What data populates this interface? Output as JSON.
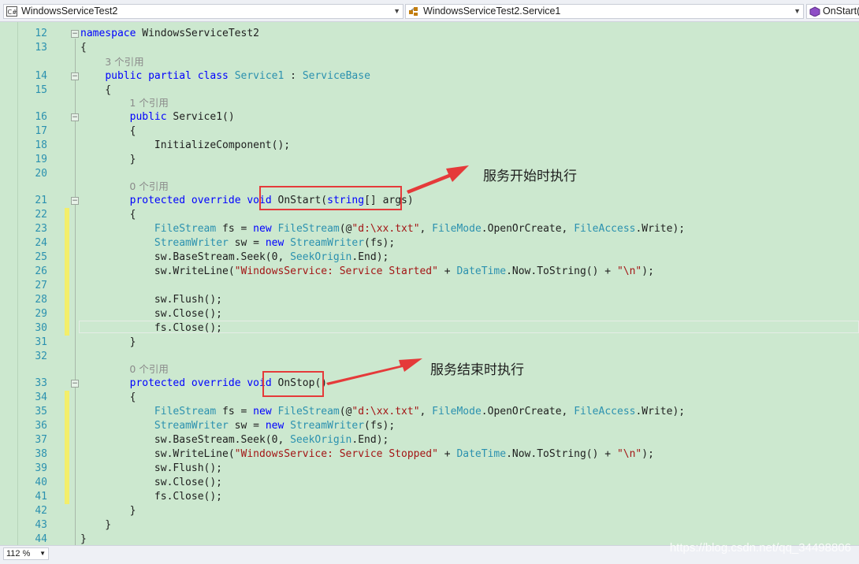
{
  "navbar": {
    "project_combo": "WindowsServiceTest2",
    "class_combo": "WindowsServiceTest2.Service1",
    "member_combo": "OnStart(s"
  },
  "editor": {
    "ref_counts": {
      "l14": "3 个引用",
      "l16": "1 个引用",
      "l21": "0 个引用",
      "l33": "0 个引用"
    },
    "line_numbers": [
      "12",
      "13",
      "14",
      "15",
      "16",
      "17",
      "18",
      "19",
      "20",
      "21",
      "22",
      "23",
      "24",
      "25",
      "26",
      "27",
      "28",
      "29",
      "30",
      "31",
      "32",
      "33",
      "34",
      "35",
      "36",
      "37",
      "38",
      "39",
      "40",
      "41",
      "42",
      "43",
      "44"
    ],
    "code": {
      "l12": [
        {
          "t": "namespace",
          "c": "kw"
        },
        {
          "t": " WindowsServiceTest2"
        }
      ],
      "l13": [
        {
          "t": "{"
        }
      ],
      "l14": [
        {
          "t": "    "
        },
        {
          "t": "public",
          "c": "kw"
        },
        {
          "t": " "
        },
        {
          "t": "partial",
          "c": "kw"
        },
        {
          "t": " "
        },
        {
          "t": "class",
          "c": "kw"
        },
        {
          "t": " "
        },
        {
          "t": "Service1",
          "c": "ty"
        },
        {
          "t": " : "
        },
        {
          "t": "ServiceBase",
          "c": "ty"
        }
      ],
      "l15": [
        {
          "t": "    {"
        }
      ],
      "l16": [
        {
          "t": "        "
        },
        {
          "t": "public",
          "c": "kw"
        },
        {
          "t": " Service1()"
        }
      ],
      "l17": [
        {
          "t": "        {"
        }
      ],
      "l18": [
        {
          "t": "            InitializeComponent();"
        }
      ],
      "l19": [
        {
          "t": "        }"
        }
      ],
      "l20": [
        {
          "t": ""
        }
      ],
      "l21": [
        {
          "t": "        "
        },
        {
          "t": "protected",
          "c": "kw"
        },
        {
          "t": " "
        },
        {
          "t": "override",
          "c": "kw"
        },
        {
          "t": " "
        },
        {
          "t": "void",
          "c": "kw"
        },
        {
          "t": " OnStart("
        },
        {
          "t": "string",
          "c": "kw"
        },
        {
          "t": "[] args)"
        }
      ],
      "l22": [
        {
          "t": "        {"
        }
      ],
      "l23": [
        {
          "t": "            "
        },
        {
          "t": "FileStream",
          "c": "ty"
        },
        {
          "t": " fs = "
        },
        {
          "t": "new",
          "c": "kw"
        },
        {
          "t": " "
        },
        {
          "t": "FileStream",
          "c": "ty"
        },
        {
          "t": "(@"
        },
        {
          "t": "\"d:\\xx.txt\"",
          "c": "st"
        },
        {
          "t": ", "
        },
        {
          "t": "FileMode",
          "c": "ty"
        },
        {
          "t": ".OpenOrCreate, "
        },
        {
          "t": "FileAccess",
          "c": "ty"
        },
        {
          "t": ".Write);"
        }
      ],
      "l24": [
        {
          "t": "            "
        },
        {
          "t": "StreamWriter",
          "c": "ty"
        },
        {
          "t": " sw = "
        },
        {
          "t": "new",
          "c": "kw"
        },
        {
          "t": " "
        },
        {
          "t": "StreamWriter",
          "c": "ty"
        },
        {
          "t": "(fs);"
        }
      ],
      "l25": [
        {
          "t": "            sw.BaseStream.Seek(0, "
        },
        {
          "t": "SeekOrigin",
          "c": "ty"
        },
        {
          "t": ".End);"
        }
      ],
      "l26": [
        {
          "t": "            sw.WriteLine("
        },
        {
          "t": "\"WindowsService: Service Started\"",
          "c": "st"
        },
        {
          "t": " + "
        },
        {
          "t": "DateTime",
          "c": "ty"
        },
        {
          "t": ".Now.ToString() + "
        },
        {
          "t": "\"\\n\"",
          "c": "st"
        },
        {
          "t": ");"
        }
      ],
      "l27": [
        {
          "t": ""
        }
      ],
      "l28": [
        {
          "t": "            sw.Flush();"
        }
      ],
      "l29": [
        {
          "t": "            sw.Close();"
        }
      ],
      "l30": [
        {
          "t": "            fs.Close();"
        }
      ],
      "l31": [
        {
          "t": "        }"
        }
      ],
      "l32": [
        {
          "t": ""
        }
      ],
      "l33": [
        {
          "t": "        "
        },
        {
          "t": "protected",
          "c": "kw"
        },
        {
          "t": " "
        },
        {
          "t": "override",
          "c": "kw"
        },
        {
          "t": " "
        },
        {
          "t": "void",
          "c": "kw"
        },
        {
          "t": " OnStop()"
        }
      ],
      "l34": [
        {
          "t": "        {"
        }
      ],
      "l35": [
        {
          "t": "            "
        },
        {
          "t": "FileStream",
          "c": "ty"
        },
        {
          "t": " fs = "
        },
        {
          "t": "new",
          "c": "kw"
        },
        {
          "t": " "
        },
        {
          "t": "FileStream",
          "c": "ty"
        },
        {
          "t": "(@"
        },
        {
          "t": "\"d:\\xx.txt\"",
          "c": "st"
        },
        {
          "t": ", "
        },
        {
          "t": "FileMode",
          "c": "ty"
        },
        {
          "t": ".OpenOrCreate, "
        },
        {
          "t": "FileAccess",
          "c": "ty"
        },
        {
          "t": ".Write);"
        }
      ],
      "l36": [
        {
          "t": "            "
        },
        {
          "t": "StreamWriter",
          "c": "ty"
        },
        {
          "t": " sw = "
        },
        {
          "t": "new",
          "c": "kw"
        },
        {
          "t": " "
        },
        {
          "t": "StreamWriter",
          "c": "ty"
        },
        {
          "t": "(fs);"
        }
      ],
      "l37": [
        {
          "t": "            sw.BaseStream.Seek(0, "
        },
        {
          "t": "SeekOrigin",
          "c": "ty"
        },
        {
          "t": ".End);"
        }
      ],
      "l38": [
        {
          "t": "            sw.WriteLine("
        },
        {
          "t": "\"WindowsService: Service Stopped\"",
          "c": "st"
        },
        {
          "t": " + "
        },
        {
          "t": "DateTime",
          "c": "ty"
        },
        {
          "t": ".Now.ToString() + "
        },
        {
          "t": "\"\\n\"",
          "c": "st"
        },
        {
          "t": ");"
        }
      ],
      "l39": [
        {
          "t": "            sw.Flush();"
        }
      ],
      "l40": [
        {
          "t": "            sw.Close();"
        }
      ],
      "l41": [
        {
          "t": "            fs.Close();"
        }
      ],
      "l42": [
        {
          "t": "        }"
        }
      ],
      "l43": [
        {
          "t": "    }"
        }
      ],
      "l44": [
        {
          "t": "}"
        }
      ]
    }
  },
  "annotations": {
    "onstart_note": "服务开始时执行",
    "onstop_note": "服务结束时执行",
    "annotation_color": "#e53a3a"
  },
  "statusbar": {
    "zoom": "112 %",
    "watermark": "https://blog.csdn.net/qq_34498806"
  },
  "colors": {
    "editor_bg": "#cce8cf",
    "keyword": "#0000ff",
    "type": "#2b91af",
    "string": "#a31515",
    "changed_marker": "#f3ee6a"
  }
}
